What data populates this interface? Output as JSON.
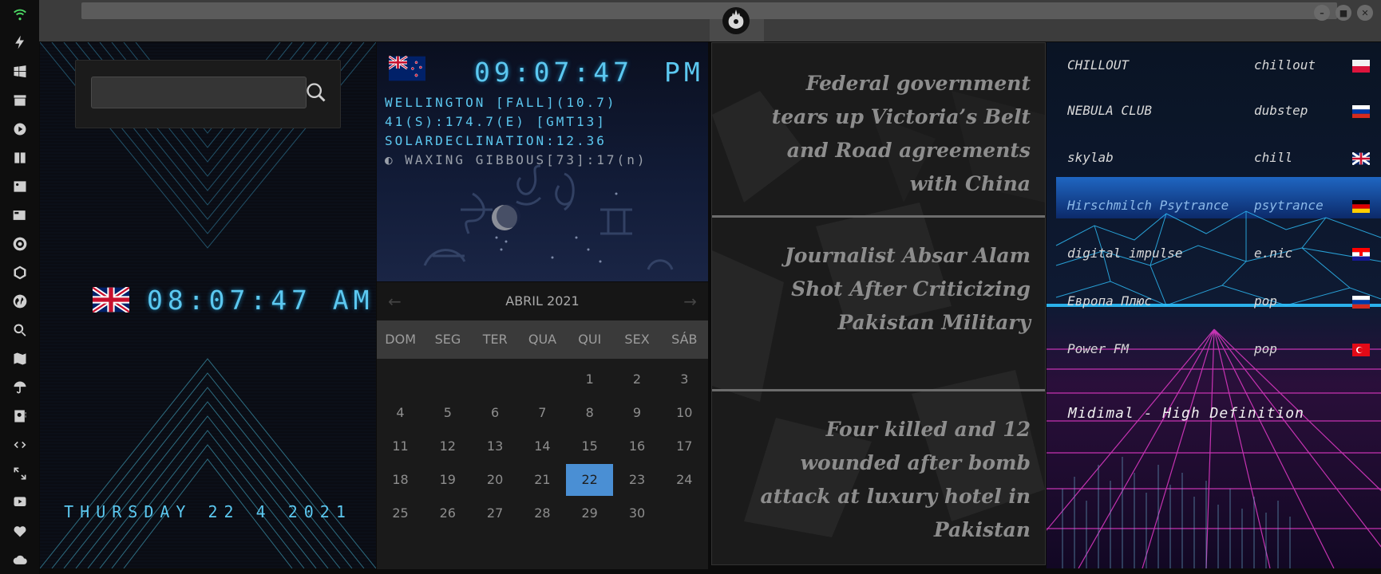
{
  "window": {
    "title": ""
  },
  "sidebar": {
    "icons": [
      "wifi-icon",
      "lightning-icon",
      "windows-icon",
      "archive-icon",
      "play-icon",
      "map-book-icon",
      "image-icon",
      "news-icon",
      "gear-icon",
      "hexagon-icon",
      "globe-icon",
      "search-icon",
      "map-icon",
      "umbrella-icon",
      "contact-icon",
      "code-icon",
      "expand-icon",
      "youtube-icon",
      "heart-icon",
      "cloud-icon"
    ],
    "accent_color": "#4cd964"
  },
  "world_clock": {
    "search_placeholder": "",
    "time": "08:07:47 AM",
    "date": "THURSDAY 22 4 2021",
    "flag": "uk-flag-icon"
  },
  "astro_clock": {
    "time": "09:07:47",
    "ampm": "PM",
    "flag": "nz-flag-icon",
    "line1": "WELLINGTON [FALL](10.7)",
    "line2": "41(S):174.7(E) [GMT13]",
    "line3": "SOLARDECLINATION:12.36",
    "line4": "WAXING GIBBOUS[73]:17(n)"
  },
  "calendar": {
    "month": "ABRIL 2021",
    "weekdays": [
      "DOM",
      "SEG",
      "TER",
      "QUA",
      "QUI",
      "SEX",
      "SÁB"
    ],
    "selected_day": 22,
    "weeks": [
      [
        "",
        "",
        "",
        "",
        "1",
        "2",
        "3"
      ],
      [
        "4",
        "5",
        "6",
        "7",
        "8",
        "9",
        "10"
      ],
      [
        "11",
        "12",
        "13",
        "14",
        "15",
        "16",
        "17"
      ],
      [
        "18",
        "19",
        "20",
        "21",
        "22",
        "23",
        "24"
      ],
      [
        "25",
        "26",
        "27",
        "28",
        "29",
        "30",
        ""
      ]
    ]
  },
  "news": {
    "headlines": [
      "Federal government tears up Victoria’s Belt and Road agreements with China",
      "Journalist Absar Alam Shot After Criticizing Pakistan Military",
      "Four killed and 12 wounded after bomb attack at luxury hotel in Pakistan"
    ]
  },
  "radio": {
    "stations": [
      {
        "name": "CHILLOUT",
        "genre": "chillout",
        "flag": "poland-flag-icon"
      },
      {
        "name": "NEBULA CLUB",
        "genre": "dubstep",
        "flag": "russia-flag-icon"
      },
      {
        "name": "skylab",
        "genre": "chill",
        "flag": "uk-flag-icon"
      },
      {
        "name": "Hirschmilch Psytrance",
        "genre": "psytrance",
        "flag": "germany-flag-icon",
        "active": true
      },
      {
        "name": "digital impulse",
        "genre": "e.nic",
        "flag": "croatia-flag-icon"
      },
      {
        "name": "Европа Плюс",
        "genre": "pop",
        "flag": "russia-flag-icon"
      },
      {
        "name": "Power FM",
        "genre": "pop",
        "flag": "turkey-flag-icon"
      }
    ],
    "now_playing": "Midimal - High Definition"
  }
}
